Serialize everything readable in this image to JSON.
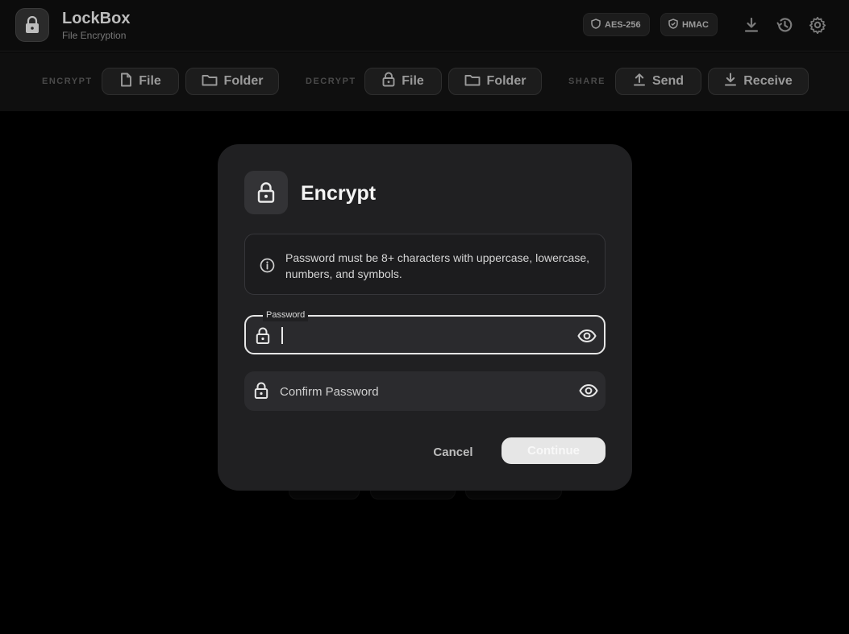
{
  "header": {
    "app_title": "LockBox",
    "app_subtitle": "File Encryption",
    "badges": [
      "AES-256",
      "HMAC"
    ],
    "icons": [
      "download-icon",
      "history-icon",
      "gear-icon"
    ]
  },
  "toolbar": {
    "encrypt": {
      "label": "ENCRYPT",
      "file": "File",
      "folder": "Folder"
    },
    "decrypt": {
      "label": "DECRYPT",
      "file": "File",
      "folder": "Folder"
    },
    "share": {
      "label": "SHARE",
      "send": "Send",
      "receive": "Receive"
    }
  },
  "modal": {
    "title": "Encrypt",
    "info_text": "Password must be 8+ characters with uppercase, lowercase, numbers, and symbols.",
    "password": {
      "label": "Password",
      "value": ""
    },
    "confirm": {
      "placeholder": "Confirm Password",
      "value": ""
    },
    "cancel_label": "Cancel",
    "continue_label": "Continue"
  },
  "colors": {
    "background": "#000000",
    "modal": "#202022",
    "accent": "#e6e6e6"
  }
}
